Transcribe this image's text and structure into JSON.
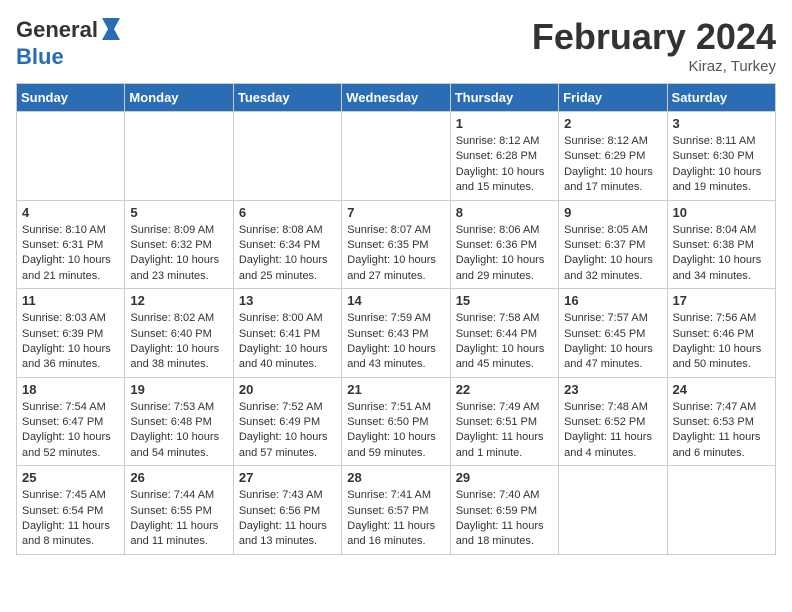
{
  "header": {
    "logo_general": "General",
    "logo_blue": "Blue",
    "month_title": "February 2024",
    "location": "Kiraz, Turkey"
  },
  "weekdays": [
    "Sunday",
    "Monday",
    "Tuesday",
    "Wednesday",
    "Thursday",
    "Friday",
    "Saturday"
  ],
  "weeks": [
    [
      {
        "day": "",
        "info": ""
      },
      {
        "day": "",
        "info": ""
      },
      {
        "day": "",
        "info": ""
      },
      {
        "day": "",
        "info": ""
      },
      {
        "day": "1",
        "info": "Sunrise: 8:12 AM\nSunset: 6:28 PM\nDaylight: 10 hours\nand 15 minutes."
      },
      {
        "day": "2",
        "info": "Sunrise: 8:12 AM\nSunset: 6:29 PM\nDaylight: 10 hours\nand 17 minutes."
      },
      {
        "day": "3",
        "info": "Sunrise: 8:11 AM\nSunset: 6:30 PM\nDaylight: 10 hours\nand 19 minutes."
      }
    ],
    [
      {
        "day": "4",
        "info": "Sunrise: 8:10 AM\nSunset: 6:31 PM\nDaylight: 10 hours\nand 21 minutes."
      },
      {
        "day": "5",
        "info": "Sunrise: 8:09 AM\nSunset: 6:32 PM\nDaylight: 10 hours\nand 23 minutes."
      },
      {
        "day": "6",
        "info": "Sunrise: 8:08 AM\nSunset: 6:34 PM\nDaylight: 10 hours\nand 25 minutes."
      },
      {
        "day": "7",
        "info": "Sunrise: 8:07 AM\nSunset: 6:35 PM\nDaylight: 10 hours\nand 27 minutes."
      },
      {
        "day": "8",
        "info": "Sunrise: 8:06 AM\nSunset: 6:36 PM\nDaylight: 10 hours\nand 29 minutes."
      },
      {
        "day": "9",
        "info": "Sunrise: 8:05 AM\nSunset: 6:37 PM\nDaylight: 10 hours\nand 32 minutes."
      },
      {
        "day": "10",
        "info": "Sunrise: 8:04 AM\nSunset: 6:38 PM\nDaylight: 10 hours\nand 34 minutes."
      }
    ],
    [
      {
        "day": "11",
        "info": "Sunrise: 8:03 AM\nSunset: 6:39 PM\nDaylight: 10 hours\nand 36 minutes."
      },
      {
        "day": "12",
        "info": "Sunrise: 8:02 AM\nSunset: 6:40 PM\nDaylight: 10 hours\nand 38 minutes."
      },
      {
        "day": "13",
        "info": "Sunrise: 8:00 AM\nSunset: 6:41 PM\nDaylight: 10 hours\nand 40 minutes."
      },
      {
        "day": "14",
        "info": "Sunrise: 7:59 AM\nSunset: 6:43 PM\nDaylight: 10 hours\nand 43 minutes."
      },
      {
        "day": "15",
        "info": "Sunrise: 7:58 AM\nSunset: 6:44 PM\nDaylight: 10 hours\nand 45 minutes."
      },
      {
        "day": "16",
        "info": "Sunrise: 7:57 AM\nSunset: 6:45 PM\nDaylight: 10 hours\nand 47 minutes."
      },
      {
        "day": "17",
        "info": "Sunrise: 7:56 AM\nSunset: 6:46 PM\nDaylight: 10 hours\nand 50 minutes."
      }
    ],
    [
      {
        "day": "18",
        "info": "Sunrise: 7:54 AM\nSunset: 6:47 PM\nDaylight: 10 hours\nand 52 minutes."
      },
      {
        "day": "19",
        "info": "Sunrise: 7:53 AM\nSunset: 6:48 PM\nDaylight: 10 hours\nand 54 minutes."
      },
      {
        "day": "20",
        "info": "Sunrise: 7:52 AM\nSunset: 6:49 PM\nDaylight: 10 hours\nand 57 minutes."
      },
      {
        "day": "21",
        "info": "Sunrise: 7:51 AM\nSunset: 6:50 PM\nDaylight: 10 hours\nand 59 minutes."
      },
      {
        "day": "22",
        "info": "Sunrise: 7:49 AM\nSunset: 6:51 PM\nDaylight: 11 hours\nand 1 minute."
      },
      {
        "day": "23",
        "info": "Sunrise: 7:48 AM\nSunset: 6:52 PM\nDaylight: 11 hours\nand 4 minutes."
      },
      {
        "day": "24",
        "info": "Sunrise: 7:47 AM\nSunset: 6:53 PM\nDaylight: 11 hours\nand 6 minutes."
      }
    ],
    [
      {
        "day": "25",
        "info": "Sunrise: 7:45 AM\nSunset: 6:54 PM\nDaylight: 11 hours\nand 8 minutes."
      },
      {
        "day": "26",
        "info": "Sunrise: 7:44 AM\nSunset: 6:55 PM\nDaylight: 11 hours\nand 11 minutes."
      },
      {
        "day": "27",
        "info": "Sunrise: 7:43 AM\nSunset: 6:56 PM\nDaylight: 11 hours\nand 13 minutes."
      },
      {
        "day": "28",
        "info": "Sunrise: 7:41 AM\nSunset: 6:57 PM\nDaylight: 11 hours\nand 16 minutes."
      },
      {
        "day": "29",
        "info": "Sunrise: 7:40 AM\nSunset: 6:59 PM\nDaylight: 11 hours\nand 18 minutes."
      },
      {
        "day": "",
        "info": ""
      },
      {
        "day": "",
        "info": ""
      }
    ]
  ]
}
